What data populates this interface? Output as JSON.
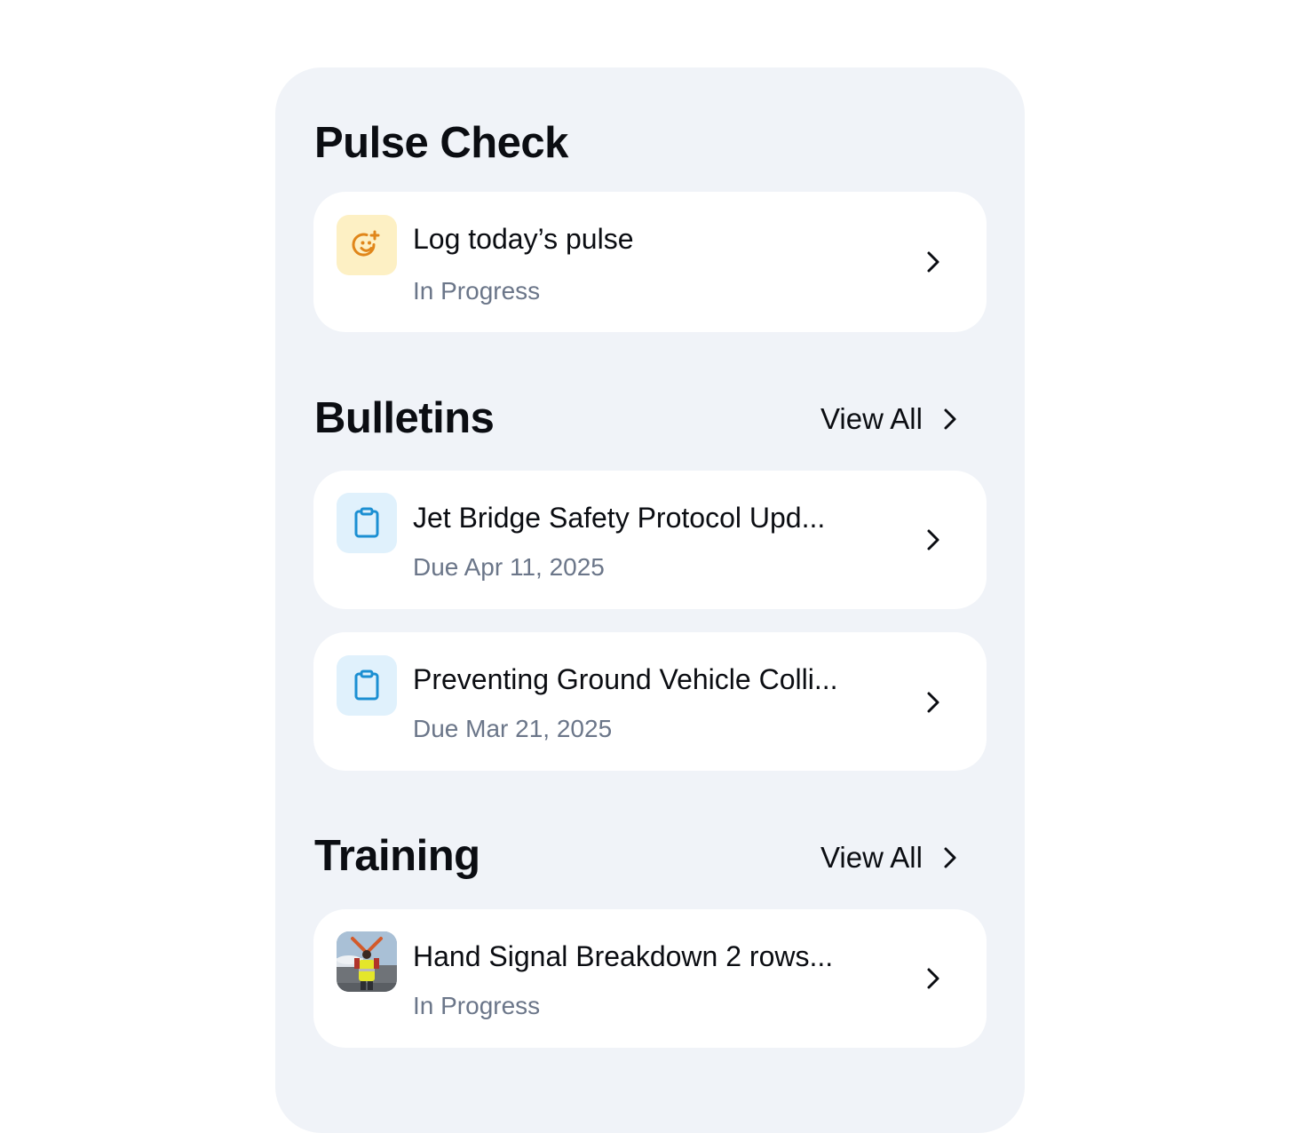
{
  "pulse_check": {
    "heading": "Pulse Check",
    "card": {
      "title": "Log today’s pulse",
      "subtitle": "In Progress",
      "icon": "smile-sparkle-icon",
      "icon_bg": "#fdf0c4",
      "icon_color": "#e0861a"
    }
  },
  "bulletins": {
    "heading": "Bulletins",
    "view_all_label": "View All",
    "items": [
      {
        "title": "Jet Bridge Safety Protocol Upd...",
        "subtitle": "Due Apr 11, 2025",
        "icon": "clipboard-icon"
      },
      {
        "title": "Preventing Ground Vehicle Colli...",
        "subtitle": "Due Mar 21, 2025",
        "icon": "clipboard-icon"
      }
    ],
    "icon_bg": "#e0f1fc",
    "icon_color": "#1b8fd2"
  },
  "training": {
    "heading": "Training",
    "view_all_label": "View All",
    "items": [
      {
        "title": "Hand Signal Breakdown 2 rows...",
        "subtitle": "In Progress",
        "icon": "training-thumbnail"
      }
    ]
  },
  "colors": {
    "panel_bg": "#f0f3f8",
    "card_bg": "#ffffff",
    "text_primary": "#0b0d12",
    "text_secondary": "#6b7689"
  }
}
